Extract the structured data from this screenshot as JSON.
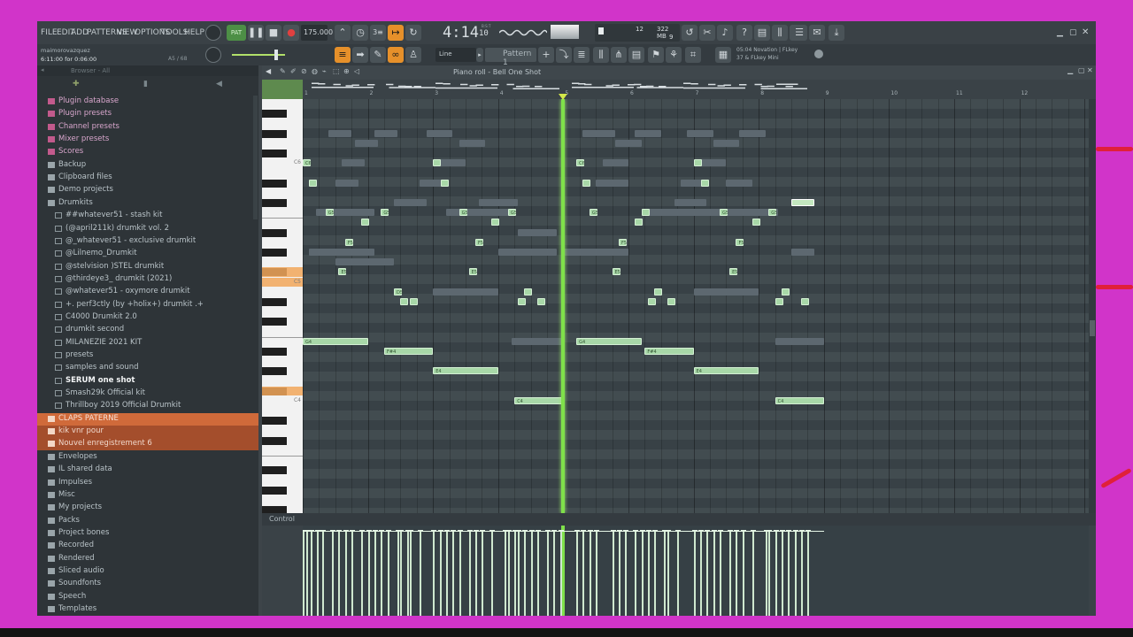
{
  "menu": [
    "FILE",
    "EDIT",
    "ADD",
    "PATTERNS",
    "VIEW",
    "OPTIONS",
    "TOOLS",
    "HELP"
  ],
  "transport": {
    "tempo": "175.000",
    "time": "4:14",
    "time_small": "10",
    "bst": "B:S:T",
    "cpu": "12",
    "ram": "322 MB",
    "polyphony": "9"
  },
  "project": {
    "user": "maimorovazquez",
    "position": "6:11:00 for 0:06:00",
    "pos_right": "A5 / 68"
  },
  "pattern": {
    "snap": "Line",
    "name": "Pattern 1"
  },
  "hint": {
    "line1": "05:04  Novation | FLkey",
    "line2": "37 & FLkey Mini"
  },
  "browser": {
    "title": "Browser - All",
    "items": [
      {
        "label": "Plugin database",
        "level": 0,
        "kind": "pink"
      },
      {
        "label": "Plugin presets",
        "level": 0,
        "kind": "pink"
      },
      {
        "label": "Channel presets",
        "level": 0,
        "kind": "pink"
      },
      {
        "label": "Mixer presets",
        "level": 0,
        "kind": "pink"
      },
      {
        "label": "Scores",
        "level": 0,
        "kind": "pink"
      },
      {
        "label": "Backup",
        "level": 0,
        "kind": "folder"
      },
      {
        "label": "Clipboard files",
        "level": 0,
        "kind": "folder"
      },
      {
        "label": "Demo projects",
        "level": 0,
        "kind": "folder"
      },
      {
        "label": "Drumkits",
        "level": 0,
        "kind": "open"
      },
      {
        "label": "##whatever51 - stash kit",
        "level": 1,
        "kind": "sub"
      },
      {
        "label": "(@april211k) drumkit vol. 2",
        "level": 1,
        "kind": "sub"
      },
      {
        "label": "@_whatever51 - exclusive drumkit",
        "level": 1,
        "kind": "sub"
      },
      {
        "label": "@Lilnemo_Drumkit",
        "level": 1,
        "kind": "sub"
      },
      {
        "label": "@stelvision )STEL drumkit",
        "level": 1,
        "kind": "sub"
      },
      {
        "label": "@thirdeye3_ drumkit (2021)",
        "level": 1,
        "kind": "sub"
      },
      {
        "label": "@whatever51 - oxymore drumkit",
        "level": 1,
        "kind": "sub"
      },
      {
        "label": "+. perf3ctly (by +holix+) drumkit .+",
        "level": 1,
        "kind": "sub"
      },
      {
        "label": "C4000 Drumkit 2.0",
        "level": 1,
        "kind": "sub"
      },
      {
        "label": "drumkit second",
        "level": 1,
        "kind": "sub"
      },
      {
        "label": "MILANEZIE 2021 KIT",
        "level": 1,
        "kind": "sub"
      },
      {
        "label": "presets",
        "level": 1,
        "kind": "sub"
      },
      {
        "label": "samples and sound",
        "level": 1,
        "kind": "sub"
      },
      {
        "label": "SERUM one shot",
        "level": 1,
        "kind": "selected"
      },
      {
        "label": "Smash29k Official kit",
        "level": 1,
        "kind": "sub"
      },
      {
        "label": "Thrillboy 2019 Official Drumkit",
        "level": 1,
        "kind": "sub"
      },
      {
        "label": "CLAPS PATERNE",
        "level": 0,
        "kind": "orange"
      },
      {
        "label": "kik vnr pour",
        "level": 0,
        "kind": "orange2"
      },
      {
        "label": "Nouvel enregistrement 6",
        "level": 0,
        "kind": "orange2"
      },
      {
        "label": "Envelopes",
        "level": 0,
        "kind": "folder"
      },
      {
        "label": "IL shared data",
        "level": 0,
        "kind": "folder"
      },
      {
        "label": "Impulses",
        "level": 0,
        "kind": "folder"
      },
      {
        "label": "Misc",
        "level": 0,
        "kind": "folder"
      },
      {
        "label": "My projects",
        "level": 0,
        "kind": "folder"
      },
      {
        "label": "Packs",
        "level": 0,
        "kind": "folder"
      },
      {
        "label": "Project bones",
        "level": 0,
        "kind": "folder"
      },
      {
        "label": "Recorded",
        "level": 0,
        "kind": "folder"
      },
      {
        "label": "Rendered",
        "level": 0,
        "kind": "folder"
      },
      {
        "label": "Sliced audio",
        "level": 0,
        "kind": "folder"
      },
      {
        "label": "Soundfonts",
        "level": 0,
        "kind": "folder"
      },
      {
        "label": "Speech",
        "level": 0,
        "kind": "folder"
      },
      {
        "label": "Templates",
        "level": 0,
        "kind": "folder"
      }
    ]
  },
  "piano_roll": {
    "title": "Piano roll - Bell One Shot",
    "bar_numbers": [
      "1",
      "2",
      "3",
      "4",
      "5",
      "6",
      "7",
      "8",
      "9",
      "10",
      "11",
      "12"
    ],
    "key_labels": [
      "C6",
      "C5",
      "C4"
    ],
    "playhead_bar": 5.0,
    "notes": [
      {
        "bar": 1.0,
        "len": 0.12,
        "row": 6,
        "label": "C6"
      },
      {
        "bar": 1.1,
        "len": 0.12,
        "row": 8,
        "label": ""
      },
      {
        "bar": 1.35,
        "len": 0.12,
        "row": 11,
        "label": "G5"
      },
      {
        "bar": 1.55,
        "len": 0.12,
        "row": 17,
        "label": "E5"
      },
      {
        "bar": 1.65,
        "len": 0.12,
        "row": 14,
        "label": "F5"
      },
      {
        "bar": 1.9,
        "len": 0.12,
        "row": 12,
        "label": ""
      },
      {
        "bar": 2.2,
        "len": 0.12,
        "row": 11,
        "label": "G5"
      },
      {
        "bar": 2.4,
        "len": 0.12,
        "row": 19,
        "label": "D5"
      },
      {
        "bar": 2.5,
        "len": 0.12,
        "row": 20,
        "label": ""
      },
      {
        "bar": 2.65,
        "len": 0.12,
        "row": 20,
        "label": ""
      },
      {
        "bar": 3.0,
        "len": 0.12,
        "row": 6,
        "label": ""
      },
      {
        "bar": 3.12,
        "len": 0.12,
        "row": 8,
        "label": ""
      },
      {
        "bar": 3.4,
        "len": 0.12,
        "row": 11,
        "label": "G5"
      },
      {
        "bar": 3.55,
        "len": 0.12,
        "row": 17,
        "label": "E5"
      },
      {
        "bar": 3.65,
        "len": 0.12,
        "row": 14,
        "label": "F5"
      },
      {
        "bar": 3.9,
        "len": 0.12,
        "row": 12,
        "label": ""
      },
      {
        "bar": 4.15,
        "len": 0.12,
        "row": 11,
        "label": "G5"
      },
      {
        "bar": 4.3,
        "len": 0.12,
        "row": 20,
        "label": ""
      },
      {
        "bar": 4.4,
        "len": 0.12,
        "row": 19,
        "label": ""
      },
      {
        "bar": 4.6,
        "len": 0.12,
        "row": 20,
        "label": ""
      },
      {
        "bar": 5.2,
        "len": 0.12,
        "row": 6,
        "label": "C6"
      },
      {
        "bar": 5.3,
        "len": 0.12,
        "row": 8,
        "label": ""
      },
      {
        "bar": 5.4,
        "len": 0.12,
        "row": 11,
        "label": "G5"
      },
      {
        "bar": 5.75,
        "len": 0.12,
        "row": 17,
        "label": "E5"
      },
      {
        "bar": 5.85,
        "len": 0.12,
        "row": 14,
        "label": "F5"
      },
      {
        "bar": 6.1,
        "len": 0.12,
        "row": 12,
        "label": ""
      },
      {
        "bar": 6.2,
        "len": 0.12,
        "row": 11,
        "label": ""
      },
      {
        "bar": 6.3,
        "len": 0.12,
        "row": 20,
        "label": ""
      },
      {
        "bar": 6.4,
        "len": 0.12,
        "row": 19,
        "label": ""
      },
      {
        "bar": 6.6,
        "len": 0.12,
        "row": 20,
        "label": ""
      },
      {
        "bar": 7.0,
        "len": 0.12,
        "row": 6,
        "label": ""
      },
      {
        "bar": 7.12,
        "len": 0.12,
        "row": 8,
        "label": ""
      },
      {
        "bar": 7.4,
        "len": 0.12,
        "row": 11,
        "label": "G5"
      },
      {
        "bar": 7.55,
        "len": 0.12,
        "row": 17,
        "label": "E5"
      },
      {
        "bar": 7.65,
        "len": 0.12,
        "row": 14,
        "label": "F5"
      },
      {
        "bar": 7.9,
        "len": 0.12,
        "row": 12,
        "label": ""
      },
      {
        "bar": 8.15,
        "len": 0.12,
        "row": 11,
        "label": "G5"
      },
      {
        "bar": 8.25,
        "len": 0.12,
        "row": 20,
        "label": ""
      },
      {
        "bar": 8.35,
        "len": 0.12,
        "row": 19,
        "label": ""
      },
      {
        "bar": 8.65,
        "len": 0.12,
        "row": 20,
        "label": ""
      },
      {
        "bar": 1.0,
        "len": 1.0,
        "row": 24,
        "label": "G4"
      },
      {
        "bar": 2.25,
        "len": 0.75,
        "row": 25,
        "label": "F#4"
      },
      {
        "bar": 3.0,
        "len": 1.0,
        "row": 27,
        "label": "E4"
      },
      {
        "bar": 4.25,
        "len": 0.75,
        "row": 30,
        "label": "C4"
      },
      {
        "bar": 5.2,
        "len": 1.0,
        "row": 24,
        "label": "G4"
      },
      {
        "bar": 6.25,
        "len": 0.75,
        "row": 25,
        "label": "F#4"
      },
      {
        "bar": 7.0,
        "len": 1.0,
        "row": 27,
        "label": "E4"
      },
      {
        "bar": 8.25,
        "len": 0.75,
        "row": 30,
        "label": "C4"
      },
      {
        "bar": 8.5,
        "len": 0.35,
        "row": 10,
        "label": "",
        "selected": true
      }
    ],
    "ghost_notes": [
      {
        "bar": 1.4,
        "len": 0.35,
        "row": 3
      },
      {
        "bar": 1.8,
        "len": 0.35,
        "row": 4
      },
      {
        "bar": 2.1,
        "len": 0.35,
        "row": 3
      },
      {
        "bar": 1.6,
        "len": 0.35,
        "row": 6
      },
      {
        "bar": 1.5,
        "len": 0.35,
        "row": 8
      },
      {
        "bar": 2.4,
        "len": 0.5,
        "row": 10
      },
      {
        "bar": 1.2,
        "len": 0.9,
        "row": 11
      },
      {
        "bar": 1.1,
        "len": 1.0,
        "row": 15
      },
      {
        "bar": 1.5,
        "len": 0.9,
        "row": 16
      },
      {
        "bar": 2.9,
        "len": 0.4,
        "row": 3
      },
      {
        "bar": 3.4,
        "len": 0.4,
        "row": 4
      },
      {
        "bar": 3.1,
        "len": 0.4,
        "row": 6
      },
      {
        "bar": 2.8,
        "len": 0.4,
        "row": 8
      },
      {
        "bar": 3.7,
        "len": 0.6,
        "row": 10
      },
      {
        "bar": 3.2,
        "len": 1.0,
        "row": 11
      },
      {
        "bar": 4.3,
        "len": 0.6,
        "row": 13
      },
      {
        "bar": 4.0,
        "len": 0.9,
        "row": 15
      },
      {
        "bar": 3.0,
        "len": 1.0,
        "row": 19
      },
      {
        "bar": 4.2,
        "len": 0.8,
        "row": 24
      },
      {
        "bar": 5.3,
        "len": 0.5,
        "row": 3
      },
      {
        "bar": 5.8,
        "len": 0.4,
        "row": 4
      },
      {
        "bar": 6.1,
        "len": 0.4,
        "row": 3
      },
      {
        "bar": 5.6,
        "len": 0.4,
        "row": 6
      },
      {
        "bar": 5.5,
        "len": 0.5,
        "row": 8
      },
      {
        "bar": 6.2,
        "len": 1.0,
        "row": 11
      },
      {
        "bar": 5.0,
        "len": 1.0,
        "row": 15
      },
      {
        "bar": 6.9,
        "len": 0.4,
        "row": 3
      },
      {
        "bar": 7.3,
        "len": 0.4,
        "row": 4
      },
      {
        "bar": 7.7,
        "len": 0.4,
        "row": 3
      },
      {
        "bar": 7.0,
        "len": 0.5,
        "row": 6
      },
      {
        "bar": 6.8,
        "len": 0.4,
        "row": 8
      },
      {
        "bar": 7.5,
        "len": 0.4,
        "row": 8
      },
      {
        "bar": 6.7,
        "len": 0.5,
        "row": 10
      },
      {
        "bar": 7.0,
        "len": 1.3,
        "row": 11
      },
      {
        "bar": 7.0,
        "len": 1.0,
        "row": 19
      },
      {
        "bar": 8.5,
        "len": 0.35,
        "row": 15
      },
      {
        "bar": 8.25,
        "len": 0.75,
        "row": 24
      }
    ],
    "velocity_bars": [
      1.0,
      1.05,
      1.12,
      1.22,
      1.3,
      1.45,
      1.55,
      1.65,
      1.75,
      1.9,
      2.0,
      2.1,
      2.2,
      2.3,
      2.45,
      2.5,
      2.6,
      2.65,
      2.8,
      3.0,
      3.1,
      3.2,
      3.3,
      3.4,
      3.55,
      3.65,
      3.75,
      3.9,
      4.1,
      4.15,
      4.25,
      4.3,
      4.4,
      4.5,
      4.6,
      4.75,
      4.85,
      4.95,
      5.2,
      5.3,
      5.4,
      5.5,
      5.75,
      5.85,
      5.95,
      6.1,
      6.2,
      6.3,
      6.4,
      6.55,
      6.6,
      6.75,
      7.0,
      7.1,
      7.2,
      7.3,
      7.4,
      7.55,
      7.65,
      7.75,
      7.9,
      8.1,
      8.15,
      8.25,
      8.35,
      8.45,
      8.55,
      8.65,
      8.75
    ]
  },
  "control": {
    "label": "Control"
  }
}
